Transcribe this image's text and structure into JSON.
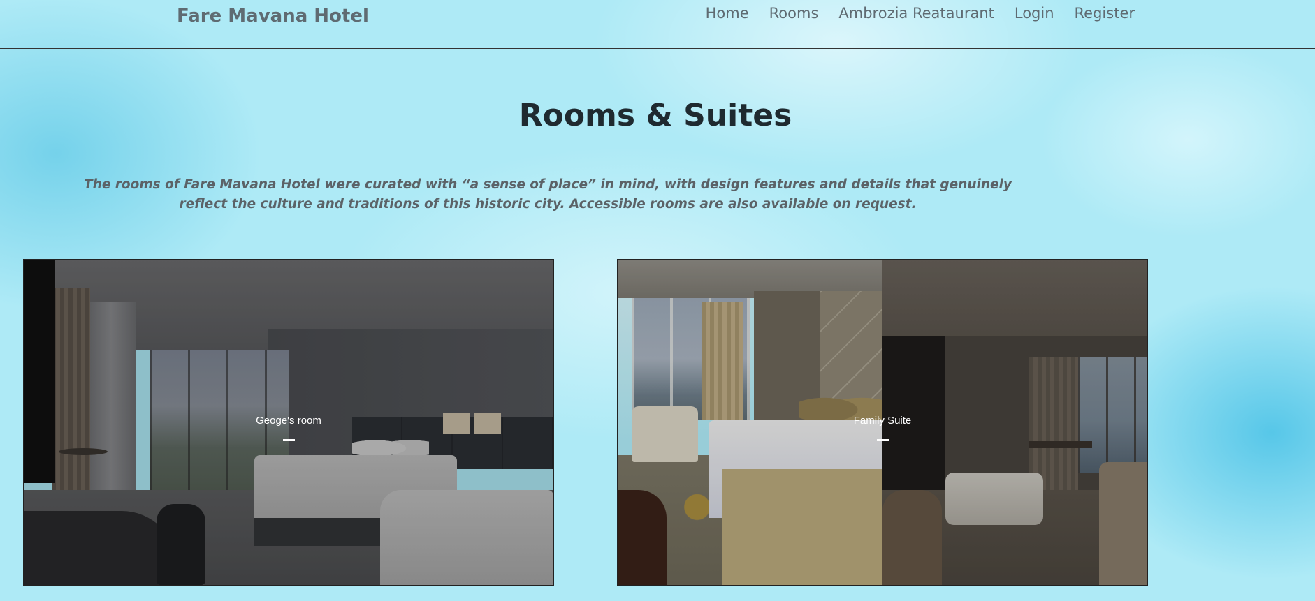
{
  "header": {
    "brand": "Fare Mavana Hotel",
    "nav": [
      {
        "label": "Home"
      },
      {
        "label": "Rooms"
      },
      {
        "label": "Ambrozia Reataurant"
      },
      {
        "label": "Login"
      },
      {
        "label": "Register"
      }
    ]
  },
  "main": {
    "title": "Rooms & Suites",
    "intro": "The rooms of Fare Mavana Hotel were curated with “a sense of place” in mind, with design features and details that genuinely reflect the culture and traditions of this historic city. Accessible rooms are also available on request.",
    "rooms": [
      {
        "caption": "Geoge's room"
      },
      {
        "caption": "Family Suite"
      }
    ]
  },
  "colors": {
    "background": "#aeeaf6",
    "nav_text": "#5f6b72",
    "title_text": "#1f2a30",
    "caption_text": "#ffffff"
  }
}
